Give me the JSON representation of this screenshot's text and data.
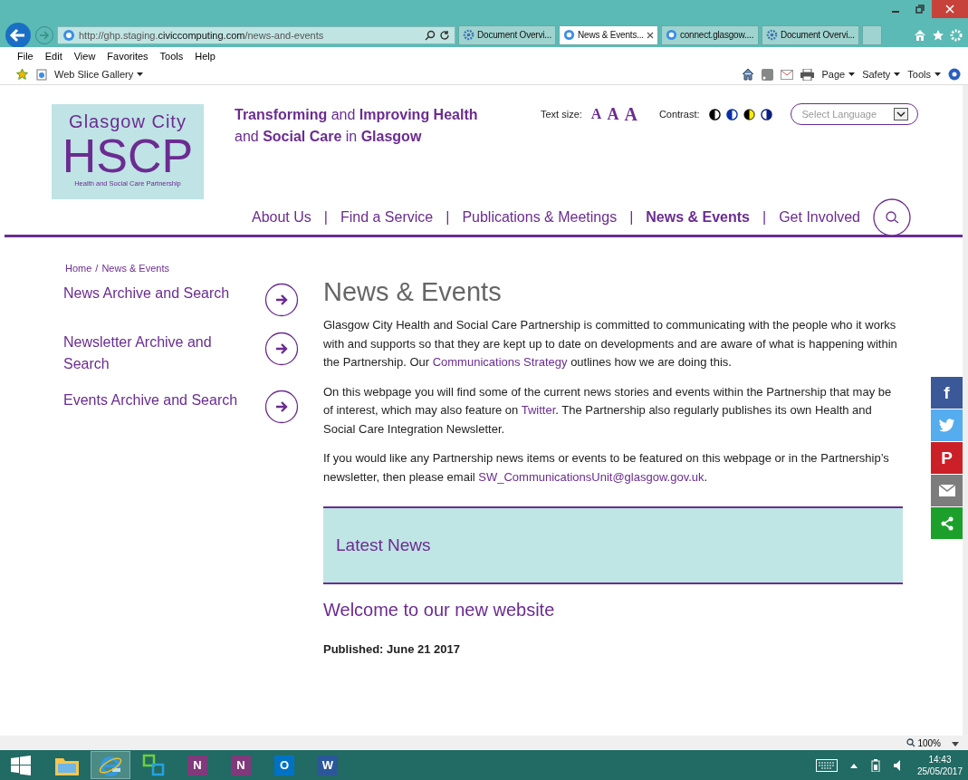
{
  "browser": {
    "url_prefix": "http://ghp.staging.",
    "url_domain": "civiccomputing.com",
    "url_path": "/news-and-events",
    "tabs": [
      {
        "label": "Document Overvi...",
        "kind": "document",
        "selected": false
      },
      {
        "label": "News & Events...",
        "kind": "web",
        "selected": true
      },
      {
        "label": "connect.glasgow....",
        "kind": "web",
        "selected": false
      },
      {
        "label": "Document Overvi...",
        "kind": "document",
        "selected": false
      }
    ],
    "menu": [
      "File",
      "Edit",
      "View",
      "Favorites",
      "Tools",
      "Help"
    ],
    "favorites": "Web Slice Gallery",
    "commands": [
      "Page",
      "Safety",
      "Tools"
    ]
  },
  "site": {
    "logo": {
      "line1": "Glasgow City",
      "line2": "HSCP",
      "line3": "Health and Social Care Partnership"
    },
    "tagline": "**Transforming** and **Improving Health** and **Social Care** in **Glasgow**",
    "text_size": {
      "label": "Text size:",
      "sizes": [
        "A",
        "A",
        "A"
      ]
    },
    "contrast": {
      "label": "Contrast:"
    },
    "language": {
      "placeholder": "Select Language"
    },
    "nav": [
      {
        "label": "About Us",
        "selected": false
      },
      {
        "label": "Find a Service",
        "selected": false
      },
      {
        "label": "Publications & Meetings",
        "selected": false
      },
      {
        "label": "News & Events",
        "selected": true
      },
      {
        "label": "Get Involved",
        "selected": false
      }
    ],
    "nav_separator": "|"
  },
  "breadcrumb": {
    "items": [
      "Home",
      "News & Events"
    ],
    "separator": "/"
  },
  "sidebar": {
    "items": [
      "News Archive and Search",
      "Newsletter Archive and Search",
      "Events Archive and Search"
    ]
  },
  "main": {
    "heading": "News & Events",
    "paragraphs": [
      [
        {
          "text": "Glasgow City Health and Social Care Partnership is committed to communicating with the people who it works with and supports so that they are kept up to date on developments and are aware of what is happening within the Partnership. Our ",
          "kind": "text"
        },
        {
          "text": "Communications Strategy",
          "kind": "link"
        },
        {
          "text": " outlines how we are doing this.",
          "kind": "text"
        }
      ],
      [
        {
          "text": "On this webpage you will find some of the current news stories and events within the Partnership that may be of interest, which may also feature on ",
          "kind": "text"
        },
        {
          "text": "Twitter",
          "kind": "link"
        },
        {
          "text": ". The Partnership also regularly publishes its own Health and Social Care Integration Newsletter.",
          "kind": "text"
        }
      ],
      [
        {
          "text": "If you would like any Partnership news items or events to be featured on this webpage or in the Partnership’s newsletter, then please email ",
          "kind": "text"
        },
        {
          "text": "SW_CommunicationsUnit@glasgow.gov.uk",
          "kind": "link"
        },
        {
          "text": ".",
          "kind": "text"
        }
      ]
    ],
    "latest_news": "Latest News",
    "article": {
      "title": "Welcome to our new website",
      "published": "Published: June 21 2017"
    }
  },
  "share": [
    {
      "kind": "facebook",
      "glyph": "f",
      "color": "#3b5998"
    },
    {
      "kind": "twitter",
      "color": "#55acee"
    },
    {
      "kind": "pinterest",
      "glyph": "P",
      "color": "#cb2027"
    },
    {
      "kind": "email",
      "color": "#7d7d7d"
    },
    {
      "kind": "share",
      "color": "#1ca02b"
    }
  ],
  "status_bar": {
    "zoom": "100%"
  },
  "taskbar": {
    "apps": [
      {
        "kind": "explorer",
        "selected": false
      },
      {
        "kind": "ie",
        "selected": true
      },
      {
        "kind": "connect",
        "selected": false
      },
      {
        "kind": "onenote",
        "glyph": "N",
        "selected": false
      },
      {
        "kind": "clipper",
        "glyph": "N",
        "selected": false
      },
      {
        "kind": "outlook",
        "glyph": "O",
        "selected": false
      },
      {
        "kind": "word",
        "glyph": "W",
        "selected": false
      }
    ],
    "time": "14:43",
    "date": "25/05/2017"
  }
}
